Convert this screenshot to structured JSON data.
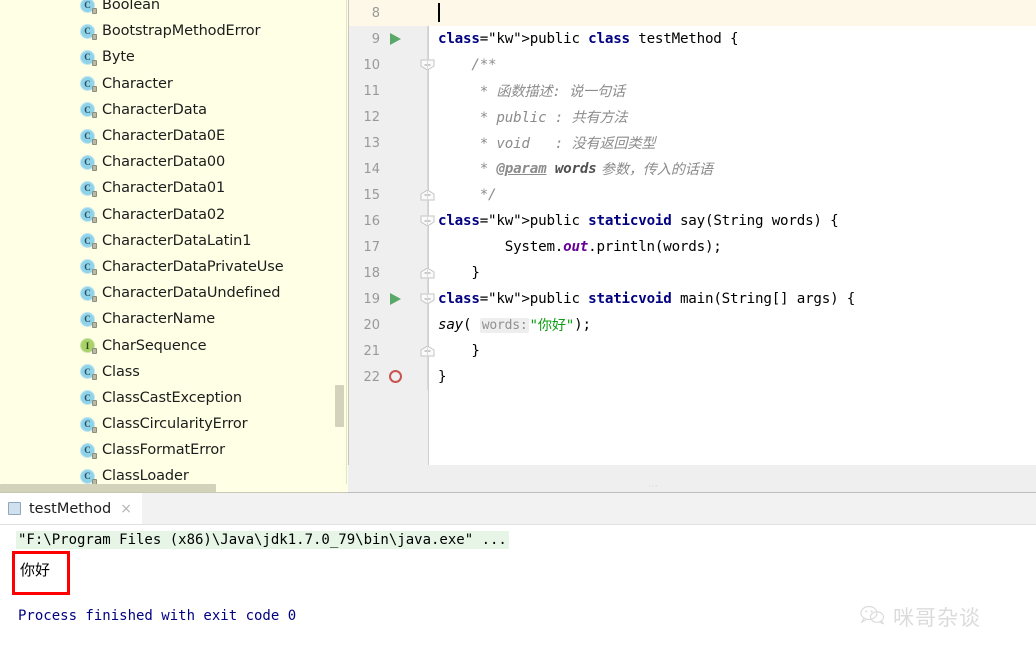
{
  "class_list": {
    "items": [
      {
        "label": "Boolean",
        "kind": "class"
      },
      {
        "label": "BootstrapMethodError",
        "kind": "class"
      },
      {
        "label": "Byte",
        "kind": "class"
      },
      {
        "label": "Character",
        "kind": "class"
      },
      {
        "label": "CharacterData",
        "kind": "class"
      },
      {
        "label": "CharacterData0E",
        "kind": "class"
      },
      {
        "label": "CharacterData00",
        "kind": "class"
      },
      {
        "label": "CharacterData01",
        "kind": "class"
      },
      {
        "label": "CharacterData02",
        "kind": "class"
      },
      {
        "label": "CharacterDataLatin1",
        "kind": "class"
      },
      {
        "label": "CharacterDataPrivateUse",
        "kind": "class"
      },
      {
        "label": "CharacterDataUndefined",
        "kind": "class"
      },
      {
        "label": "CharacterName",
        "kind": "class"
      },
      {
        "label": "CharSequence",
        "kind": "interface"
      },
      {
        "label": "Class",
        "kind": "class"
      },
      {
        "label": "ClassCastException",
        "kind": "class"
      },
      {
        "label": "ClassCircularityError",
        "kind": "class"
      },
      {
        "label": "ClassFormatError",
        "kind": "class"
      },
      {
        "label": "ClassLoader",
        "kind": "class"
      }
    ],
    "class_icon_letter": "C",
    "interface_icon_letter": "I",
    "class_icon_color": "#8fd3e8",
    "interface_icon_color": "#a8d16a",
    "background_color": "#ffffe6"
  },
  "editor": {
    "current_line": 8,
    "lines": [
      {
        "num": "8",
        "text": "",
        "current": true,
        "marker": "caret"
      },
      {
        "num": "9",
        "text": "public class testMethod {",
        "marker": "run"
      },
      {
        "num": "10",
        "text": "    /**",
        "fold": "open"
      },
      {
        "num": "11",
        "text": "     * 函数描述: 说一句话"
      },
      {
        "num": "12",
        "text": "     * public : 共有方法"
      },
      {
        "num": "13",
        "text": "     * void   : 没有返回类型"
      },
      {
        "num": "14",
        "text": "     * @param words 参数，传入的话语"
      },
      {
        "num": "15",
        "text": "     */",
        "fold": "close"
      },
      {
        "num": "16",
        "text": "    public static void say(String words) {",
        "fold": "open"
      },
      {
        "num": "17",
        "text": "        System.out.println(words);"
      },
      {
        "num": "18",
        "text": "    }",
        "fold": "close"
      },
      {
        "num": "19",
        "text": "    public static void main(String[] args) {",
        "marker": "run",
        "fold": "open"
      },
      {
        "num": "20",
        "text": "        say( words: \"你好\");"
      },
      {
        "num": "21",
        "text": "    }",
        "fold": "close"
      },
      {
        "num": "22",
        "text": "}",
        "marker": "breakpoint"
      }
    ],
    "parameter_hint": "words:",
    "string_literal": "\"你好\"",
    "javadoc_tag": "@param",
    "javadoc_param_name": "words",
    "colors": {
      "keyword": "#000080",
      "comment": "#8c8c8c",
      "string": "#0f9d15",
      "static_field": "#660099",
      "current_line_bg": "#fdf8e7",
      "gutter_bg": "#efefef",
      "run_marker": "#59a869",
      "breakpoint": "#c75450"
    }
  },
  "console": {
    "tab": {
      "label": "testMethod",
      "close_glyph": "×"
    },
    "command_line": "\"F:\\Program Files (x86)\\Java\\jdk1.7.0_79\\bin\\java.exe\" ...",
    "output": "你好",
    "finished_line": "Process finished with exit code 0",
    "command_bg": "#e7f5e7",
    "finished_color": "#000080",
    "annotation_box_color": "#ff0000"
  },
  "watermark": {
    "text": "咪哥杂谈",
    "icon": "wechat-icon"
  }
}
